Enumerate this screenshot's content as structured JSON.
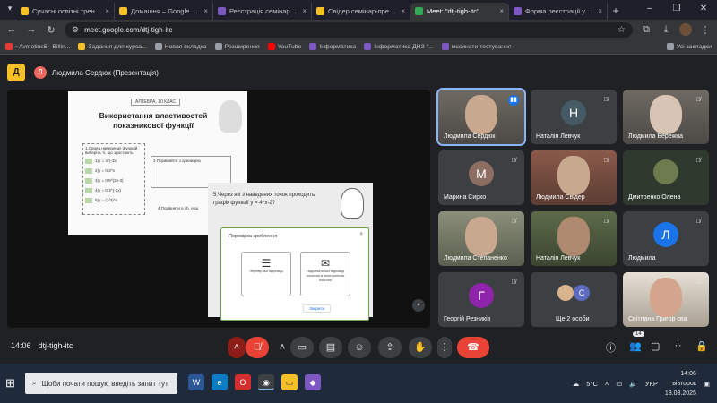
{
  "browser": {
    "tabs": [
      {
        "title": "Сучасні освітні тренди сфе",
        "color": "#f6c026"
      },
      {
        "title": "Домашня – Google Диск",
        "color": "#f6c026"
      },
      {
        "title": "Реєстрація семінару мате",
        "color": "#7e57c2"
      },
      {
        "title": "Свідер семінар-презента",
        "color": "#f6c026"
      },
      {
        "title": "Meet: \"dtj-tigh-itc\"",
        "color": "#34a853"
      },
      {
        "title": "Форма реєстрації учасни",
        "color": "#7e57c2"
      }
    ],
    "new_tab": "+",
    "url": "meet.google.com/dtj-tigh-itc",
    "bookmarks": [
      {
        "label": "~Avmotins5~ Billin...",
        "color": "#e53935"
      },
      {
        "label": "Задания для курса...",
        "color": "#f6c026"
      },
      {
        "label": "Новая вкладка",
        "color": "#9aa0a6"
      },
      {
        "label": "Розширення",
        "color": "#9aa0a6"
      },
      {
        "label": "YouTube",
        "color": "#ff0000"
      },
      {
        "label": "Інформатика",
        "color": "#7e57c2"
      },
      {
        "label": "Інформатика ДНЗ \"...",
        "color": "#7e57c2"
      },
      {
        "label": "мєсинати тестування",
        "color": "#7e57c2"
      }
    ],
    "all_bookmarks": "Усі закладки"
  },
  "meet": {
    "logo_letter": "Д",
    "presenter_initial": "Л",
    "presenter_label": "Людмила Сердюк (Презентація)",
    "slide": {
      "header": "АЛГЕБРА, 10 КЛАС",
      "title": "Використання властивостей показникової функції",
      "q1": "1.Серед наведених функцій виберіть ті, що зростають",
      "functions": [
        "1)y = 4^(-3x)",
        "2)y = 0,3^x",
        "3)y = 0,9^(2x-3)",
        "4)y = 0,3^(-2x)",
        "5)y = (2/3)^x"
      ],
      "q2": "2.Порівняйте з одиницею",
      "q4": "4.Порівняти a і b, якщ",
      "q5": "5.Через які з наведених точок проходить графік функції y = 4^x-2?"
    },
    "dialog": {
      "title": "Перевірка зроблення",
      "option1": "Перевір мої відповіді",
      "option2": "Надсилати мої відповіді очоплою в електронною поштою",
      "button": "Закрити"
    },
    "participants": [
      {
        "name": "Людмила Сердюк",
        "kind": "photo",
        "talking": true
      },
      {
        "name": "Наталія Левчук",
        "kind": "letter",
        "letter": "Н",
        "color": "#455a64"
      },
      {
        "name": "Людмила Бережна",
        "kind": "photo"
      },
      {
        "name": "Марина Сирко",
        "kind": "letter",
        "letter": "М",
        "color": "#8d6e63"
      },
      {
        "name": "Людмила Свідер",
        "kind": "photo"
      },
      {
        "name": "Дмитренко Олена",
        "kind": "photo"
      },
      {
        "name": "Людмила Степаненко",
        "kind": "photo"
      },
      {
        "name": "Наталія Левчук",
        "kind": "photo"
      },
      {
        "name": "Людмила",
        "kind": "letter",
        "letter": "Л",
        "color": "#1a73e8"
      },
      {
        "name": "Георгій Резників",
        "kind": "letter",
        "letter": "Г",
        "color": "#8e24aa"
      },
      {
        "name": "Ще 2 особи",
        "kind": "more",
        "letter": "С"
      },
      {
        "name": "Світлана Григор сва",
        "kind": "photo"
      }
    ],
    "time": "14:06",
    "meeting_code": "dtj-tigh-itc",
    "people_count": "14"
  },
  "taskbar": {
    "search_placeholder": "Щоби почати пошук, введіть запит тут",
    "weather": "5°C",
    "lang": "УКР",
    "time": "14:06",
    "weekday": "вівторок",
    "date": "18.03.2025"
  }
}
